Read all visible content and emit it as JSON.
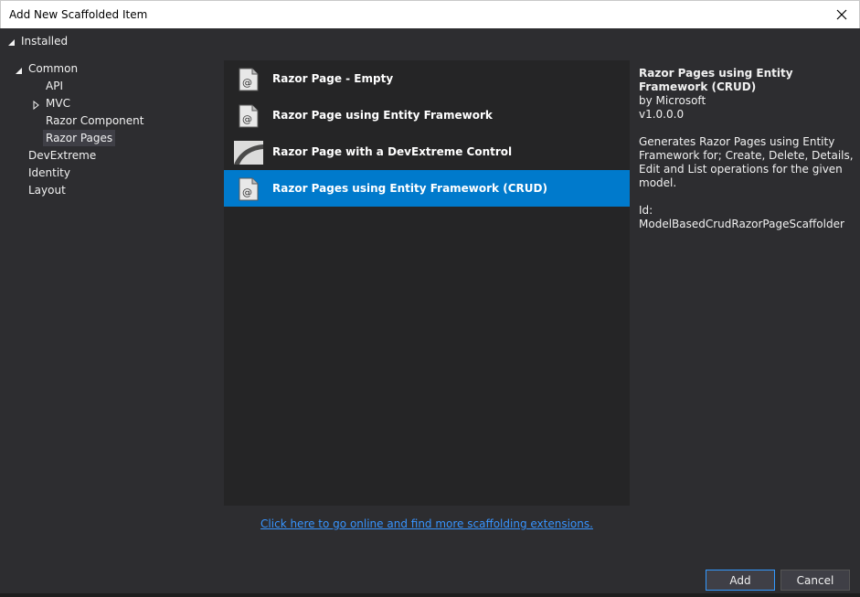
{
  "window": {
    "title": "Add New Scaffolded Item"
  },
  "installed_label": "Installed",
  "tree": {
    "common": "Common",
    "api": "API",
    "mvc": "MVC",
    "razor_component": "Razor Component",
    "razor_pages": "Razor Pages",
    "devextreme": "DevExtreme",
    "identity": "Identity",
    "layout": "Layout"
  },
  "templates": [
    {
      "label": "Razor Page - Empty",
      "icon": "razor-page-icon"
    },
    {
      "label": "Razor Page using Entity Framework",
      "icon": "razor-page-icon"
    },
    {
      "label": "Razor Page with a DevExtreme Control",
      "icon": "devextreme-icon"
    },
    {
      "label": "Razor Pages using Entity Framework (CRUD)",
      "icon": "razor-page-icon",
      "selected": true
    }
  ],
  "details": {
    "title": "Razor Pages using Entity Framework (CRUD)",
    "author": "by Microsoft",
    "version": "v1.0.0.0",
    "description": "Generates Razor Pages using Entity Framework for; Create, Delete, Details, Edit and List operations for the given model.",
    "id": "Id: ModelBasedCrudRazorPageScaffolder"
  },
  "online_link": "Click here to go online and find more scaffolding extensions.",
  "buttons": {
    "add": "Add",
    "cancel": "Cancel"
  },
  "colors": {
    "selection": "#007acc",
    "link": "#3794ff",
    "background": "#2d2d30",
    "list_background": "#252526"
  }
}
